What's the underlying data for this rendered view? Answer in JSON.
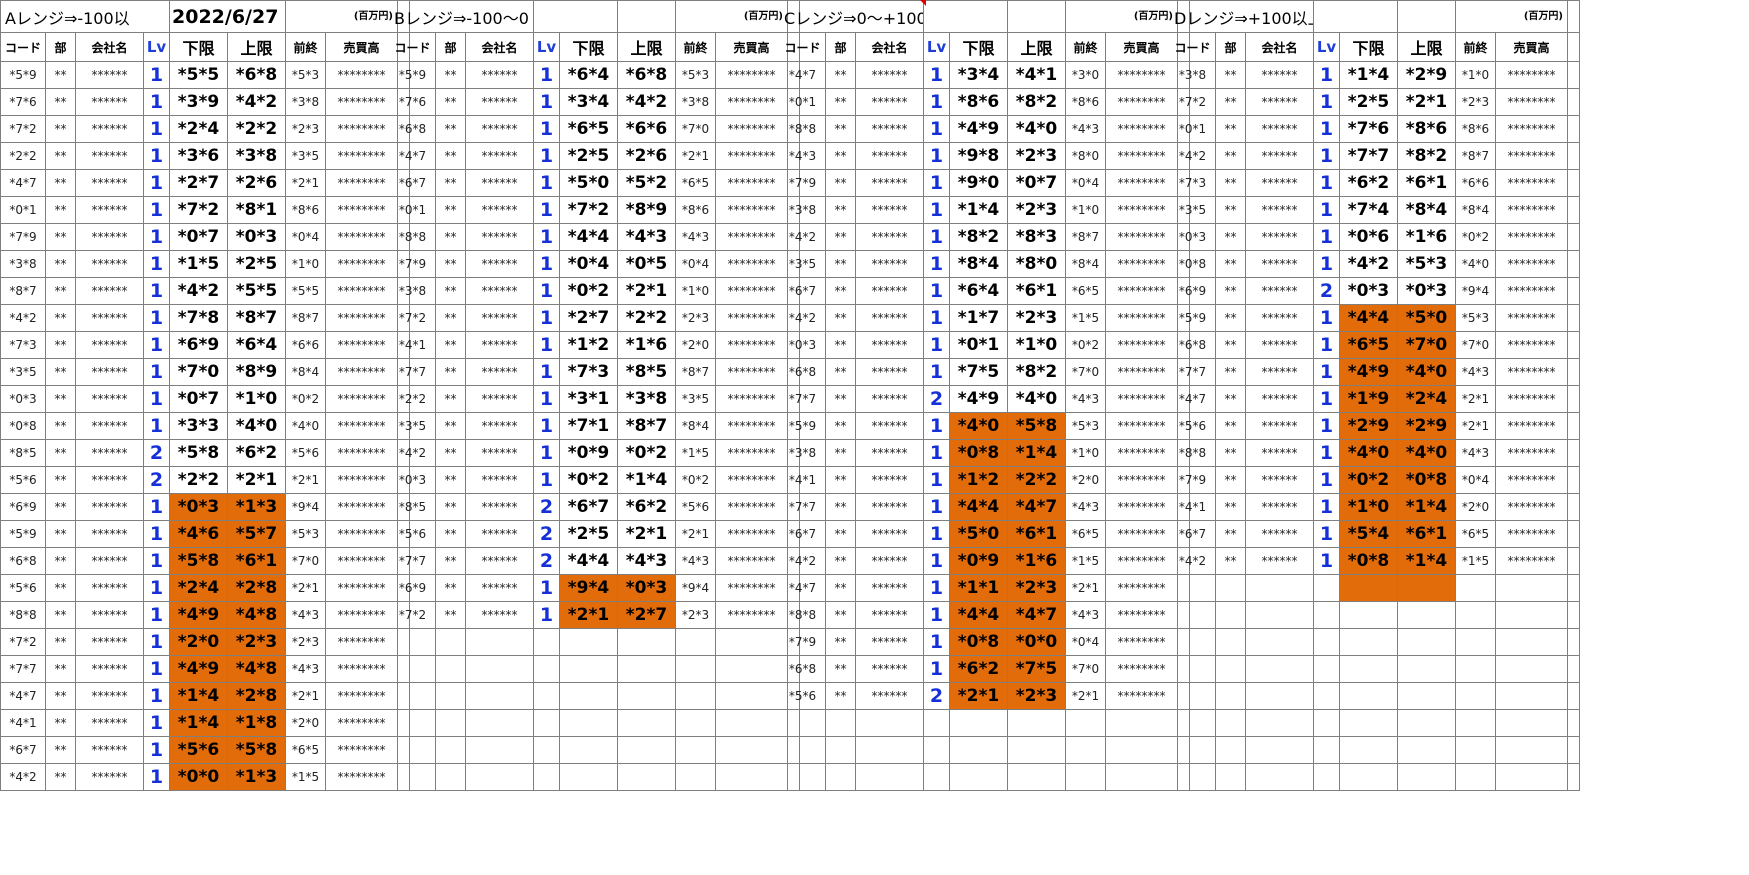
{
  "sheet": {
    "date": "2022/6/27",
    "unit": "(百万円)",
    "headers": [
      "コード",
      "部",
      "会社名",
      "Lv",
      "下限",
      "上限",
      "前終",
      "売買高"
    ],
    "blocks": [
      {
        "title": "Aレンジ⇒-100以",
        "rows": [
          [
            "*5*9",
            "**",
            "******",
            "1",
            "*5*5",
            "*6*8",
            "*5*3",
            "********",
            0
          ],
          [
            "*7*6",
            "**",
            "******",
            "1",
            "*3*9",
            "*4*2",
            "*3*8",
            "********",
            0
          ],
          [
            "*7*2",
            "**",
            "******",
            "1",
            "*2*4",
            "*2*2",
            "*2*3",
            "********",
            0
          ],
          [
            "*2*2",
            "**",
            "******",
            "1",
            "*3*6",
            "*3*8",
            "*3*5",
            "********",
            0
          ],
          [
            "*4*7",
            "**",
            "******",
            "1",
            "*2*7",
            "*2*6",
            "*2*1",
            "********",
            0
          ],
          [
            "*0*1",
            "**",
            "******",
            "1",
            "*7*2",
            "*8*1",
            "*8*6",
            "********",
            0
          ],
          [
            "*7*9",
            "**",
            "******",
            "1",
            "*0*7",
            "*0*3",
            "*0*4",
            "********",
            0
          ],
          [
            "*3*8",
            "**",
            "******",
            "1",
            "*1*5",
            "*2*5",
            "*1*0",
            "********",
            0
          ],
          [
            "*8*7",
            "**",
            "******",
            "1",
            "*4*2",
            "*5*5",
            "*5*5",
            "********",
            0
          ],
          [
            "*4*2",
            "**",
            "******",
            "1",
            "*7*8",
            "*8*7",
            "*8*7",
            "********",
            0
          ],
          [
            "*7*3",
            "**",
            "******",
            "1",
            "*6*9",
            "*6*4",
            "*6*6",
            "********",
            0
          ],
          [
            "*3*5",
            "**",
            "******",
            "1",
            "*7*0",
            "*8*9",
            "*8*4",
            "********",
            0
          ],
          [
            "*0*3",
            "**",
            "******",
            "1",
            "*0*7",
            "*1*0",
            "*0*2",
            "********",
            0
          ],
          [
            "*0*8",
            "**",
            "******",
            "1",
            "*3*3",
            "*4*0",
            "*4*0",
            "********",
            0
          ],
          [
            "*8*5",
            "**",
            "******",
            "2",
            "*5*8",
            "*6*2",
            "*5*6",
            "********",
            0
          ],
          [
            "*5*6",
            "**",
            "******",
            "2",
            "*2*2",
            "*2*1",
            "*2*1",
            "********",
            0
          ],
          [
            "*6*9",
            "**",
            "******",
            "1",
            "*0*3",
            "*1*3",
            "*9*4",
            "********",
            1
          ],
          [
            "*5*9",
            "**",
            "******",
            "1",
            "*4*6",
            "*5*7",
            "*5*3",
            "********",
            1
          ],
          [
            "*6*8",
            "**",
            "******",
            "1",
            "*5*8",
            "*6*1",
            "*7*0",
            "********",
            1
          ],
          [
            "*5*6",
            "**",
            "******",
            "1",
            "*2*4",
            "*2*8",
            "*2*1",
            "********",
            1
          ],
          [
            "*8*8",
            "**",
            "******",
            "1",
            "*4*9",
            "*4*8",
            "*4*3",
            "********",
            1
          ],
          [
            "*7*2",
            "**",
            "******",
            "1",
            "*2*0",
            "*2*3",
            "*2*3",
            "********",
            1
          ],
          [
            "*7*7",
            "**",
            "******",
            "1",
            "*4*9",
            "*4*8",
            "*4*3",
            "********",
            1
          ],
          [
            "*4*7",
            "**",
            "******",
            "1",
            "*1*4",
            "*2*8",
            "*2*1",
            "********",
            1
          ],
          [
            "*4*1",
            "**",
            "******",
            "1",
            "*1*4",
            "*1*8",
            "*2*0",
            "********",
            1
          ],
          [
            "*6*7",
            "**",
            "******",
            "1",
            "*5*6",
            "*5*8",
            "*6*5",
            "********",
            1
          ],
          [
            "*4*2",
            "**",
            "******",
            "1",
            "*0*0",
            "*1*3",
            "*1*5",
            "********",
            1
          ]
        ]
      },
      {
        "title": "Bレンジ⇒-100〜0",
        "rows": [
          [
            "*5*9",
            "**",
            "******",
            "1",
            "*6*4",
            "*6*8",
            "*5*3",
            "********",
            0
          ],
          [
            "*7*6",
            "**",
            "******",
            "1",
            "*3*4",
            "*4*2",
            "*3*8",
            "********",
            0
          ],
          [
            "*6*8",
            "**",
            "******",
            "1",
            "*6*5",
            "*6*6",
            "*7*0",
            "********",
            0
          ],
          [
            "*4*7",
            "**",
            "******",
            "1",
            "*2*5",
            "*2*6",
            "*2*1",
            "********",
            0
          ],
          [
            "*6*7",
            "**",
            "******",
            "1",
            "*5*0",
            "*5*2",
            "*6*5",
            "********",
            0
          ],
          [
            "*0*1",
            "**",
            "******",
            "1",
            "*7*2",
            "*8*9",
            "*8*6",
            "********",
            0
          ],
          [
            "*8*8",
            "**",
            "******",
            "1",
            "*4*4",
            "*4*3",
            "*4*3",
            "********",
            0
          ],
          [
            "*7*9",
            "**",
            "******",
            "1",
            "*0*4",
            "*0*5",
            "*0*4",
            "********",
            0
          ],
          [
            "*3*8",
            "**",
            "******",
            "1",
            "*0*2",
            "*2*1",
            "*1*0",
            "********",
            0
          ],
          [
            "*7*2",
            "**",
            "******",
            "1",
            "*2*7",
            "*2*2",
            "*2*3",
            "********",
            0
          ],
          [
            "*4*1",
            "**",
            "******",
            "1",
            "*1*2",
            "*1*6",
            "*2*0",
            "********",
            0
          ],
          [
            "*7*7",
            "**",
            "******",
            "1",
            "*7*3",
            "*8*5",
            "*8*7",
            "********",
            0
          ],
          [
            "*2*2",
            "**",
            "******",
            "1",
            "*3*1",
            "*3*8",
            "*3*5",
            "********",
            0
          ],
          [
            "*3*5",
            "**",
            "******",
            "1",
            "*7*1",
            "*8*7",
            "*8*4",
            "********",
            0
          ],
          [
            "*4*2",
            "**",
            "******",
            "1",
            "*0*9",
            "*0*2",
            "*1*5",
            "********",
            0
          ],
          [
            "*0*3",
            "**",
            "******",
            "1",
            "*0*2",
            "*1*4",
            "*0*2",
            "********",
            0
          ],
          [
            "*8*5",
            "**",
            "******",
            "2",
            "*6*7",
            "*6*2",
            "*5*6",
            "********",
            0
          ],
          [
            "*5*6",
            "**",
            "******",
            "2",
            "*2*5",
            "*2*1",
            "*2*1",
            "********",
            0
          ],
          [
            "*7*7",
            "**",
            "******",
            "2",
            "*4*4",
            "*4*3",
            "*4*3",
            "********",
            0
          ],
          [
            "*6*9",
            "**",
            "******",
            "1",
            "*9*4",
            "*0*3",
            "*9*4",
            "********",
            1
          ],
          [
            "*7*2",
            "**",
            "******",
            "1",
            "*2*1",
            "*2*7",
            "*2*3",
            "********",
            1
          ]
        ]
      },
      {
        "title": "Cレンジ⇒0〜+100",
        "rows": [
          [
            "*4*7",
            "**",
            "******",
            "1",
            "*3*4",
            "*4*1",
            "*3*0",
            "********",
            0
          ],
          [
            "*0*1",
            "**",
            "******",
            "1",
            "*8*6",
            "*8*2",
            "*8*6",
            "********",
            0
          ],
          [
            "*8*8",
            "**",
            "******",
            "1",
            "*4*9",
            "*4*0",
            "*4*3",
            "********",
            0
          ],
          [
            "*4*3",
            "**",
            "******",
            "1",
            "*9*8",
            "*2*3",
            "*8*0",
            "********",
            0
          ],
          [
            "*7*9",
            "**",
            "******",
            "1",
            "*9*0",
            "*0*7",
            "*0*4",
            "********",
            0
          ],
          [
            "*3*8",
            "**",
            "******",
            "1",
            "*1*4",
            "*2*3",
            "*1*0",
            "********",
            0
          ],
          [
            "*4*2",
            "**",
            "******",
            "1",
            "*8*2",
            "*8*3",
            "*8*7",
            "********",
            0
          ],
          [
            "*3*5",
            "**",
            "******",
            "1",
            "*8*4",
            "*8*0",
            "*8*4",
            "********",
            0
          ],
          [
            "*6*7",
            "**",
            "******",
            "1",
            "*6*4",
            "*6*1",
            "*6*5",
            "********",
            0
          ],
          [
            "*4*2",
            "**",
            "******",
            "1",
            "*1*7",
            "*2*3",
            "*1*5",
            "********",
            0
          ],
          [
            "*0*3",
            "**",
            "******",
            "1",
            "*0*1",
            "*1*0",
            "*0*2",
            "********",
            0
          ],
          [
            "*6*8",
            "**",
            "******",
            "1",
            "*7*5",
            "*8*2",
            "*7*0",
            "********",
            0
          ],
          [
            "*7*7",
            "**",
            "******",
            "2",
            "*4*9",
            "*4*0",
            "*4*3",
            "********",
            0
          ],
          [
            "*5*9",
            "**",
            "******",
            "1",
            "*4*0",
            "*5*8",
            "*5*3",
            "********",
            1
          ],
          [
            "*3*8",
            "**",
            "******",
            "1",
            "*0*8",
            "*1*4",
            "*1*0",
            "********",
            1
          ],
          [
            "*4*1",
            "**",
            "******",
            "1",
            "*1*2",
            "*2*2",
            "*2*0",
            "********",
            1
          ],
          [
            "*7*7",
            "**",
            "******",
            "1",
            "*4*4",
            "*4*7",
            "*4*3",
            "********",
            1
          ],
          [
            "*6*7",
            "**",
            "******",
            "1",
            "*5*0",
            "*6*1",
            "*6*5",
            "********",
            1
          ],
          [
            "*4*2",
            "**",
            "******",
            "1",
            "*0*9",
            "*1*6",
            "*1*5",
            "********",
            1
          ],
          [
            "*4*7",
            "**",
            "******",
            "1",
            "*1*1",
            "*2*3",
            "*2*1",
            "********",
            1
          ],
          [
            "*8*8",
            "**",
            "******",
            "1",
            "*4*4",
            "*4*7",
            "*4*3",
            "********",
            1
          ],
          [
            "*7*9",
            "**",
            "******",
            "1",
            "*0*8",
            "*0*0",
            "*0*4",
            "********",
            1
          ],
          [
            "*6*8",
            "**",
            "******",
            "1",
            "*6*2",
            "*7*5",
            "*7*0",
            "********",
            1
          ],
          [
            "*5*6",
            "**",
            "******",
            "2",
            "*2*1",
            "*2*3",
            "*2*1",
            "********",
            1
          ]
        ]
      },
      {
        "title": "Dレンジ⇒+100以上",
        "rows": [
          [
            "*3*8",
            "**",
            "******",
            "1",
            "*1*4",
            "*2*9",
            "*1*0",
            "********",
            0
          ],
          [
            "*7*2",
            "**",
            "******",
            "1",
            "*2*5",
            "*2*1",
            "*2*3",
            "********",
            0
          ],
          [
            "*0*1",
            "**",
            "******",
            "1",
            "*7*6",
            "*8*6",
            "*8*6",
            "********",
            0
          ],
          [
            "*4*2",
            "**",
            "******",
            "1",
            "*7*7",
            "*8*2",
            "*8*7",
            "********",
            0
          ],
          [
            "*7*3",
            "**",
            "******",
            "1",
            "*6*2",
            "*6*1",
            "*6*6",
            "********",
            0
          ],
          [
            "*3*5",
            "**",
            "******",
            "1",
            "*7*4",
            "*8*4",
            "*8*4",
            "********",
            0
          ],
          [
            "*0*3",
            "**",
            "******",
            "1",
            "*0*6",
            "*1*6",
            "*0*2",
            "********",
            0
          ],
          [
            "*0*8",
            "**",
            "******",
            "1",
            "*4*2",
            "*5*3",
            "*4*0",
            "********",
            0
          ],
          [
            "*6*9",
            "**",
            "******",
            "2",
            "*0*3",
            "*0*3",
            "*9*4",
            "********",
            0
          ],
          [
            "*5*9",
            "**",
            "******",
            "1",
            "*4*4",
            "*5*0",
            "*5*3",
            "********",
            1
          ],
          [
            "*6*8",
            "**",
            "******",
            "1",
            "*6*5",
            "*7*0",
            "*7*0",
            "********",
            1
          ],
          [
            "*7*7",
            "**",
            "******",
            "1",
            "*4*9",
            "*4*0",
            "*4*3",
            "********",
            1
          ],
          [
            "*4*7",
            "**",
            "******",
            "1",
            "*1*9",
            "*2*4",
            "*2*1",
            "********",
            1
          ],
          [
            "*5*6",
            "**",
            "******",
            "1",
            "*2*9",
            "*2*9",
            "*2*1",
            "********",
            1
          ],
          [
            "*8*8",
            "**",
            "******",
            "1",
            "*4*0",
            "*4*0",
            "*4*3",
            "********",
            1
          ],
          [
            "*7*9",
            "**",
            "******",
            "1",
            "*0*2",
            "*0*8",
            "*0*4",
            "********",
            1
          ],
          [
            "*4*1",
            "**",
            "******",
            "1",
            "*1*0",
            "*1*4",
            "*2*0",
            "********",
            1
          ],
          [
            "*6*7",
            "**",
            "******",
            "1",
            "*5*4",
            "*6*1",
            "*6*5",
            "********",
            1
          ],
          [
            "*4*2",
            "**",
            "******",
            "1",
            "*0*8",
            "*1*4",
            "*1*5",
            "********",
            1
          ],
          [
            "",
            "",
            "",
            "",
            "",
            "",
            "",
            "",
            1
          ]
        ]
      }
    ],
    "colors": {
      "highlight": "#e26b0a",
      "lv_blue": "#1530d8",
      "grid": "#7f7f7f"
    }
  }
}
